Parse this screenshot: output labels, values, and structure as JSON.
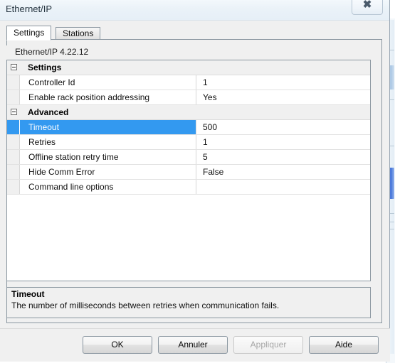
{
  "window": {
    "title": "Ethernet/IP",
    "close_label": "✖",
    "close_icon": "close-icon"
  },
  "tabs": [
    {
      "label": "Settings",
      "selected": true
    },
    {
      "label": "Stations",
      "selected": false
    }
  ],
  "grid": {
    "header": "Ethernet/IP 4.22.12",
    "rows": [
      {
        "type": "group",
        "name": "Settings",
        "value": "",
        "expanded": true,
        "selected": false
      },
      {
        "type": "item",
        "name": "Controller Id",
        "value": "1",
        "selected": false
      },
      {
        "type": "item",
        "name": "Enable rack position addressing",
        "value": "Yes",
        "selected": false
      },
      {
        "type": "group",
        "name": "Advanced",
        "value": "",
        "expanded": true,
        "selected": false
      },
      {
        "type": "item",
        "name": "Timeout",
        "value": "500",
        "selected": true
      },
      {
        "type": "item",
        "name": "Retries",
        "value": "1",
        "selected": false
      },
      {
        "type": "item",
        "name": "Offline station retry time",
        "value": "5",
        "selected": false
      },
      {
        "type": "item",
        "name": "Hide Comm Error",
        "value": "False",
        "selected": false
      },
      {
        "type": "item",
        "name": "Command line options",
        "value": "",
        "selected": false
      }
    ]
  },
  "description": {
    "title": "Timeout",
    "text": "The number of milliseconds between retries when communication fails."
  },
  "buttons": [
    {
      "label": "OK",
      "name": "ok-button",
      "disabled": false
    },
    {
      "label": "Annuler",
      "name": "cancel-button",
      "disabled": false
    },
    {
      "label": "Appliquer",
      "name": "apply-button",
      "disabled": true
    },
    {
      "label": "Aide",
      "name": "help-button",
      "disabled": false
    }
  ],
  "colors": {
    "selection": "#3399f0",
    "dialog_background": "#f0f0f0",
    "grid_background": "#ffffff",
    "border": "#8a96a0"
  }
}
